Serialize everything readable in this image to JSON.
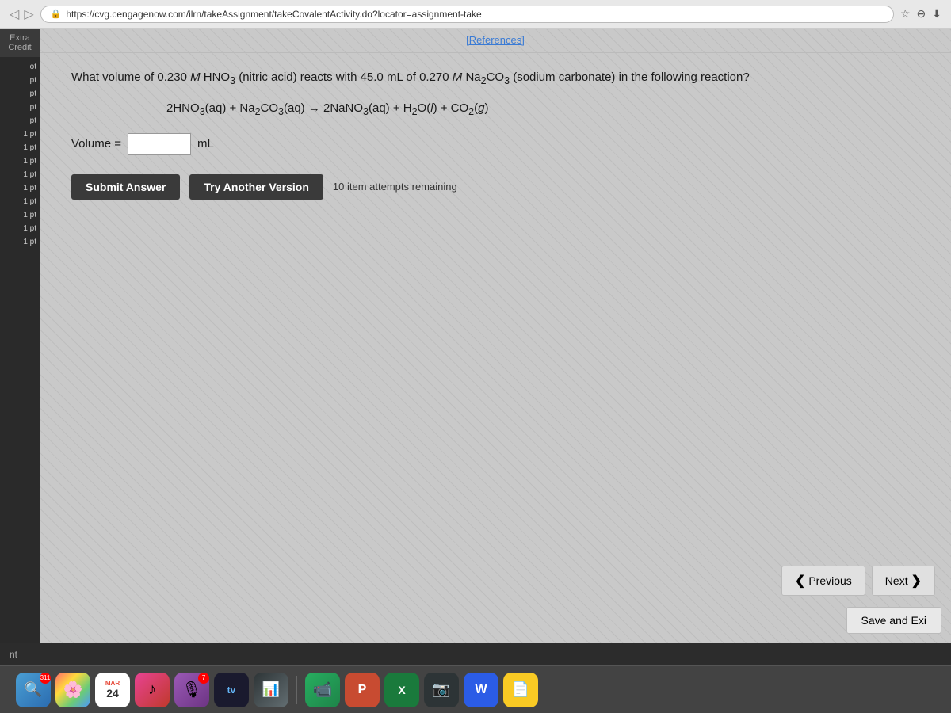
{
  "browser": {
    "url": "https://cvg.cengagenow.com/ilrn/takeAssignment/takeCovalentActivity.do?locator=assignment-take",
    "star_icon": "☆",
    "download_icon": "⬇",
    "lock_icon": "🔒"
  },
  "topbar": {
    "extra_credit_label": "Extra Credit",
    "references_label": "[References]"
  },
  "question": {
    "text": "What volume of 0.230 M HNO₃ (nitric acid) reacts with 45.0 mL of 0.270 M Na₂CO₃ (sodium carbonate) in the following reaction?",
    "equation_text": "2HNO₃(aq) + Na₂CO₃(aq) → 2NaNO₃(aq) + H₂O(l) + CO₂(g)",
    "volume_label": "Volume =",
    "volume_unit": "mL",
    "volume_value": ""
  },
  "buttons": {
    "submit_label": "Submit Answer",
    "try_another_label": "Try Another Version",
    "attempts_text": "10 item attempts remaining"
  },
  "navigation": {
    "previous_label": "Previous",
    "next_label": "Next",
    "save_exit_label": "Save and Exi"
  },
  "sidebar": {
    "items": [
      {
        "label": "pt"
      },
      {
        "label": "pt"
      },
      {
        "label": "pt"
      },
      {
        "label": "pt"
      },
      {
        "label": "pt"
      },
      {
        "label": "1 pt"
      },
      {
        "label": "1 pt"
      },
      {
        "label": "1 pt"
      },
      {
        "label": "1 pt"
      },
      {
        "label": "1 pt"
      },
      {
        "label": "1 pt"
      },
      {
        "label": "1 pt"
      },
      {
        "label": "1 pt"
      },
      {
        "label": "1 pt"
      }
    ]
  },
  "dock": {
    "date_label": "24",
    "month_label": "MAR",
    "tv_label": "tv",
    "badge_count": "311",
    "num7": "7",
    "items": [
      {
        "name": "finder",
        "label": "F"
      },
      {
        "name": "photos",
        "label": "🌸"
      },
      {
        "name": "calendar",
        "label": "24"
      },
      {
        "name": "music",
        "label": "♪"
      },
      {
        "name": "podcast",
        "label": "🎙"
      },
      {
        "name": "tv",
        "label": "tv"
      },
      {
        "name": "stocks",
        "label": "📈"
      },
      {
        "name": "facetime",
        "label": "📹"
      },
      {
        "name": "powerpoint",
        "label": "P"
      },
      {
        "name": "excel",
        "label": "X"
      },
      {
        "name": "camera",
        "label": "📷"
      },
      {
        "name": "word",
        "label": "W"
      },
      {
        "name": "notes",
        "label": "📄"
      }
    ]
  },
  "bottom_bar": {
    "label": "nt"
  }
}
